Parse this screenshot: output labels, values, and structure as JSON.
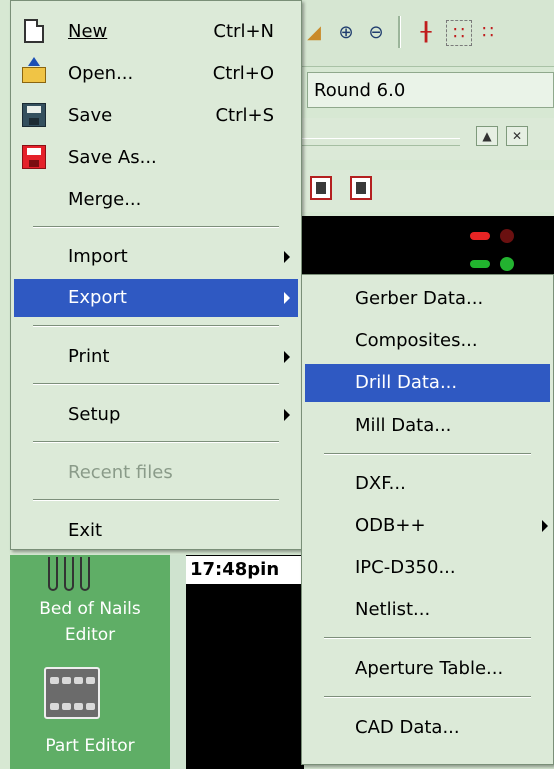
{
  "background": {
    "round_field_value": "Round 6.0",
    "close_glyph": "✕",
    "restore_glyph": "▲",
    "time_label": "17:48pin",
    "tools": [
      {
        "label_line1": "Bed of Nails",
        "label_line2": "Editor"
      },
      {
        "label_line1": "Part Editor"
      }
    ]
  },
  "file_menu": {
    "items": [
      {
        "label": "New",
        "shortcut": "Ctrl+N",
        "icon": "new-document-icon"
      },
      {
        "label": "Open...",
        "shortcut": "Ctrl+O",
        "icon": "open-folder-icon"
      },
      {
        "label": "Save",
        "shortcut": "Ctrl+S",
        "icon": "save-disk-icon"
      },
      {
        "label": "Save As...",
        "icon": "save-as-disk-icon"
      },
      {
        "label": "Merge..."
      },
      {
        "label": "Import",
        "has_submenu": true
      },
      {
        "label": "Export",
        "has_submenu": true,
        "highlighted": true
      },
      {
        "label": "Print",
        "has_submenu": true
      },
      {
        "label": "Setup",
        "has_submenu": true
      },
      {
        "label": "Recent files",
        "disabled": true
      },
      {
        "label": "Exit"
      }
    ]
  },
  "export_submenu": {
    "items": [
      {
        "label": "Gerber Data..."
      },
      {
        "label": "Composites..."
      },
      {
        "label": "Drill Data...",
        "highlighted": true
      },
      {
        "label": "Mill Data..."
      },
      {
        "label": "DXF..."
      },
      {
        "label": "ODB++",
        "has_submenu": true
      },
      {
        "label": "IPC-D350..."
      },
      {
        "label": "Netlist..."
      },
      {
        "label": "Aperture Table..."
      },
      {
        "label": "CAD Data..."
      }
    ]
  },
  "colors": {
    "menu_bg": "#dcead8",
    "highlight": "#2f59c2",
    "tool_panel": "#5fae66"
  }
}
